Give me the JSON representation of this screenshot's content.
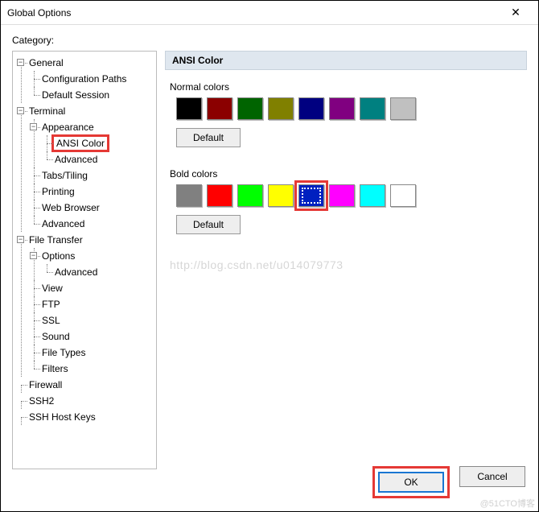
{
  "title": "Global Options",
  "category_label": "Category:",
  "section_header": "ANSI Color",
  "tree": {
    "general": "General",
    "config_paths": "Configuration Paths",
    "default_session": "Default Session",
    "terminal": "Terminal",
    "appearance": "Appearance",
    "ansi_color": "ANSI Color",
    "advanced1": "Advanced",
    "tabs": "Tabs/Tiling",
    "printing": "Printing",
    "web_browser": "Web Browser",
    "advanced2": "Advanced",
    "file_transfer": "File Transfer",
    "options": "Options",
    "advanced3": "Advanced",
    "view": "View",
    "ftp": "FTP",
    "ssl": "SSL",
    "sound": "Sound",
    "file_types": "File Types",
    "filters": "Filters",
    "firewall": "Firewall",
    "ssh2": "SSH2",
    "ssh_host_keys": "SSH Host Keys"
  },
  "normal": {
    "title": "Normal colors",
    "default_btn": "Default",
    "colors": [
      "#000000",
      "#8b0000",
      "#006400",
      "#808000",
      "#000080",
      "#800080",
      "#008080",
      "#c0c0c0"
    ]
  },
  "bold": {
    "title": "Bold colors",
    "default_btn": "Default",
    "colors": [
      "#808080",
      "#ff0000",
      "#00ff00",
      "#ffff00",
      "#0020c0",
      "#ff00ff",
      "#00ffff",
      "#ffffff"
    ]
  },
  "buttons": {
    "ok": "OK",
    "cancel": "Cancel"
  },
  "watermark": "http://blog.csdn.net/u014079773",
  "watermark2": "@51CTO博客"
}
